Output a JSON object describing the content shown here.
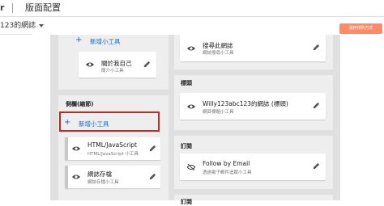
{
  "header": {
    "app_letter": "r",
    "page_title": "版面配置"
  },
  "blog_selector": {
    "name": "123的網誌"
  },
  "toolbar": {
    "save_label": "儲存排列方式"
  },
  "left_column": {
    "top_add_label": "新增小工具",
    "top_gadget": {
      "name": "關於我自己",
      "type": "簡介小工具"
    },
    "section_title": "側欄(縮節)",
    "add_label": "新增小工具",
    "gadgets": [
      {
        "name": "HTML/JavaScript",
        "type": "HTML/JavaScript 小工具"
      },
      {
        "name": "網誌存檔",
        "type": "網誌存檔小工具"
      }
    ]
  },
  "right_column": {
    "top_gadget": {
      "name": "搜尋此網誌",
      "type": "網誌搜尋小工具"
    },
    "header_section": {
      "title": "標頭",
      "gadget": {
        "name": "Willy123abc123的網誌 (標頭)",
        "type": "網頁標題小工具"
      }
    },
    "subscribe_section": {
      "title": "訂閱",
      "gadget": {
        "name": "Follow by Email",
        "type": "透過電子郵件追蹤小工具"
      }
    },
    "bottom_title": "訂閱"
  }
}
